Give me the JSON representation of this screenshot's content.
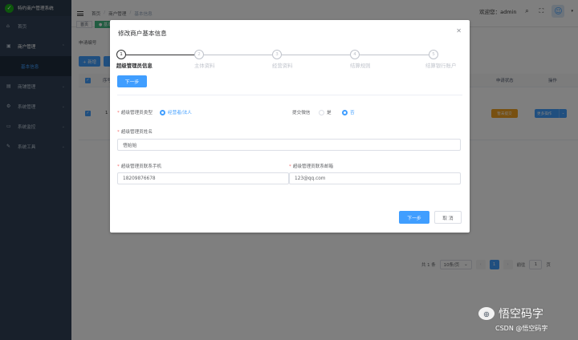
{
  "app": {
    "logo_glyph": "✓",
    "title": "特约商户管理系统"
  },
  "sidebar": {
    "items": [
      {
        "icon": "home-icon",
        "glyph": "⌂",
        "label": "首页",
        "arrow": ""
      },
      {
        "icon": "store-icon",
        "glyph": "▣",
        "label": "商户管理",
        "arrow": "⌃"
      },
      {
        "icon": "",
        "glyph": "",
        "label": "基本信息",
        "arrow": ""
      },
      {
        "icon": "shop-icon",
        "glyph": "▤",
        "label": "商铺管理",
        "arrow": "⌄"
      },
      {
        "icon": "gear-icon",
        "glyph": "⚙",
        "label": "系统管理",
        "arrow": "⌄"
      },
      {
        "icon": "monitor-icon",
        "glyph": "▭",
        "label": "系统监控",
        "arrow": "⌄"
      },
      {
        "icon": "tools-icon",
        "glyph": "✎",
        "label": "系统工具",
        "arrow": "⌄"
      }
    ]
  },
  "navbar": {
    "breadcrumb": [
      "首页",
      "商户管理",
      "基本信息"
    ],
    "separator": "/",
    "welcome": "欢迎您：admin",
    "search_glyph": "⌕",
    "fullscreen_glyph": "⛶",
    "avatar_glyph": "☺",
    "avatar_arrow": "▾"
  },
  "tags": [
    "首页",
    "● 基本"
  ],
  "content": {
    "filter_label": "申请编号",
    "add_label": "+ 新增",
    "table": {
      "col_seq": "序号",
      "col_state": "申请状态",
      "col_op": "操作",
      "checkbox_glyph": "✓",
      "rows": [
        {
          "seq": "1",
          "state": "暂未提交",
          "op": "更多操作",
          "op_arrow": "⌄"
        }
      ]
    },
    "pagination": {
      "total": "共 1 条",
      "page_size": "10条/页",
      "size_arrow": "⌄",
      "prev": "‹",
      "current": "1",
      "next": "›",
      "goto_label": "前往",
      "goto_value": "1",
      "page_unit": "页"
    }
  },
  "dialog": {
    "title": "修改商户基本信息",
    "close_glyph": "✕",
    "steps": [
      {
        "num": "1",
        "label": "超级管理员信息"
      },
      {
        "num": "2",
        "label": "主体资料"
      },
      {
        "num": "3",
        "label": "经营资料"
      },
      {
        "num": "4",
        "label": "结算规则"
      },
      {
        "num": "5",
        "label": "结算银行账户"
      }
    ],
    "next_top": "下一步",
    "form": {
      "admin_type_label": "超级管理员类型",
      "admin_type_option": "经营者/法人",
      "wechat_label": "提交微信",
      "wechat_yes": "是",
      "wechat_no": "否",
      "admin_name_label": "超级管理员姓名",
      "admin_name_value": "悟始始",
      "phone_label": "超级管理员联系手机",
      "phone_value": "18209876678",
      "email_label": "超级管理员联系邮箱",
      "email_value": "123@qq.com",
      "required_mark": "*"
    },
    "next_button": "下一步",
    "cancel_button": "取 消"
  },
  "watermark": {
    "icon_glyph": "◎",
    "main": "悟空码字",
    "sub": "CSDN @悟空码字"
  }
}
